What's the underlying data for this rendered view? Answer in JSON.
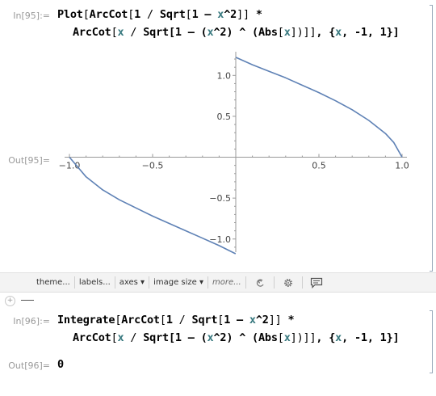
{
  "cells": {
    "in95_label": "In[95]:=",
    "in95_line1": {
      "plot": "Plot",
      "ob1": "[",
      "arccot": "ArcCot",
      "ob2": "[",
      "one": "1",
      "slash": " / ",
      "sqrt": "Sqrt",
      "ob3": "[",
      "body": "1 – ",
      "x": "x",
      "pow": "^2",
      "close": "]]",
      "star": " *"
    },
    "in95_line2": {
      "arccot": "ArcCot",
      "ob": "[",
      "x1": "x",
      "slash": " / ",
      "sqrt": "Sqrt",
      "mid": "[1 – (",
      "x2": "x",
      "pow": "^2) ^ (",
      "abs": "Abs",
      "ob2": "[",
      "x3": "x",
      "tail": "])]]",
      "comma": ", {",
      "x4": "x",
      "range": ", -1, 1}]"
    },
    "out95_label": "Out[95]=",
    "in96_label": "In[96]:=",
    "in96_line1": {
      "fn": "Integrate",
      "ob1": "[",
      "arccot": "ArcCot",
      "ob2": "[",
      "one": "1",
      "slash": " / ",
      "sqrt": "Sqrt",
      "ob3": "[",
      "body": "1 – ",
      "x": "x",
      "pow": "^2",
      "close": "]]",
      "star": " *"
    },
    "in96_line2": {
      "arccot": "ArcCot",
      "ob": "[",
      "x1": "x",
      "slash": " / ",
      "sqrt": "Sqrt",
      "mid": "[1 – (",
      "x2": "x",
      "pow": "^2) ^ (",
      "abs": "Abs",
      "ob2": "[",
      "x3": "x",
      "tail": "])]]",
      "comma": ", {",
      "x4": "x",
      "range": ", -1, 1}]"
    },
    "out96_label": "Out[96]=",
    "out96_value": "0"
  },
  "toolbar": {
    "theme": "theme...",
    "labels": "labels...",
    "axes": "axes ▾",
    "image_size": "image size ▾",
    "more": "more...",
    "icons": [
      "swirl-icon",
      "gear-icon",
      "comment-icon"
    ]
  },
  "colors": {
    "curve": "#5e81b5",
    "variable": "#3a7a80",
    "label": "#9a9a9a"
  },
  "chart_data": {
    "type": "line",
    "title": "",
    "xlabel": "",
    "ylabel": "",
    "xlim": [
      -1,
      1
    ],
    "ylim": [
      -1.2,
      1.25
    ],
    "xticks": [
      -1.0,
      -0.5,
      0.5,
      1.0
    ],
    "xtick_labels": [
      "-1.0",
      "-0.5",
      "0.5",
      "1.0"
    ],
    "yticks": [
      -1.0,
      -0.5,
      0.5,
      1.0
    ],
    "ytick_labels": [
      "-1.0",
      "-0.5",
      "0.5",
      "1.0"
    ],
    "series": [
      {
        "name": "",
        "x": [
          -1.0,
          -0.9,
          -0.8,
          -0.7,
          -0.6,
          -0.5,
          -0.4,
          -0.3,
          -0.2,
          -0.1,
          -0.001,
          0.001,
          0.1,
          0.2,
          0.3,
          0.4,
          0.5,
          0.6,
          0.7,
          0.8,
          0.9,
          0.95,
          1.0
        ],
        "y": [
          0.0,
          -0.24,
          -0.4,
          -0.52,
          -0.62,
          -0.72,
          -0.81,
          -0.9,
          -0.99,
          -1.08,
          -1.18,
          1.22,
          1.13,
          1.05,
          0.97,
          0.88,
          0.79,
          0.69,
          0.58,
          0.45,
          0.29,
          0.18,
          0.0
        ]
      }
    ],
    "grid": false
  }
}
